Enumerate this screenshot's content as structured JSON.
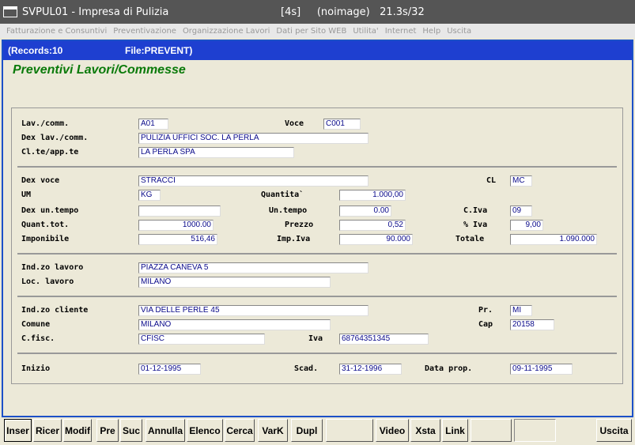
{
  "window": {
    "title": "SVPUL01 - Impresa di Pulizia",
    "info": "[4s]     (noimage)   21.3s/32"
  },
  "menu": [
    "Fatturazione e Consuntivi",
    "Preventivazione",
    "Organizzazione Lavori",
    "Dati per Sito WEB",
    "Utilita'",
    "Internet",
    "Help",
    "Uscita"
  ],
  "header": {
    "records": "(Records:10",
    "file": "File:PREVENT)"
  },
  "page_title": "Preventivi Lavori/Commesse",
  "labels": {
    "lav_comm": "Lav./comm.",
    "voce": "Voce",
    "dex_lav_comm": "Dex lav./comm.",
    "clte_appte": "Cl.te/app.te",
    "dex_voce": "Dex voce",
    "cl": "CL",
    "um": "UM",
    "quantita": "Quantita`",
    "dex_un_tempo": "Dex un.tempo",
    "un_tempo": "Un.tempo",
    "c_iva": "C.Iva",
    "quant_tot": "Quant.tot.",
    "prezzo": "Prezzo",
    "perc_iva": "% Iva",
    "imponibile": "Imponibile",
    "imp_iva": "Imp.Iva",
    "totale": "Totale",
    "ind_lavoro": "Ind.zo lavoro",
    "loc_lavoro": "Loc. lavoro",
    "ind_cliente": "Ind.zo cliente",
    "pr": "Pr.",
    "comune": "Comune",
    "cap": "Cap",
    "c_fisc": "C.fisc.",
    "iva": "Iva",
    "inizio": "Inizio",
    "scad": "Scad.",
    "data_prop": "Data prop."
  },
  "fields": {
    "lav_comm": "A01",
    "voce": "C001",
    "dex_lav_comm": "PULIZIA UFFICI SOC. LA PERLA",
    "clte_appte": "LA PERLA SPA",
    "dex_voce": "STRACCI",
    "cl": "MC",
    "um": "KG",
    "quantita": "1.000,00",
    "dex_un_tempo": "",
    "un_tempo": "0.00",
    "c_iva": "09",
    "quant_tot": "1000.00",
    "prezzo": "0,52",
    "perc_iva": "9,00",
    "imponibile": "516,46",
    "imp_iva": "90.000",
    "totale": "1.090.000",
    "ind_lavoro": "PIAZZA CANEVA 5",
    "loc_lavoro": "MILANO",
    "ind_cliente": "VIA DELLE PERLE 45",
    "pr": "MI",
    "comune": "MILANO",
    "cap": "20158",
    "c_fisc": "CFISC",
    "iva": "68764351345",
    "inizio": "01-12-1995",
    "scad": "31-12-1996",
    "data_prop": "09-11-1995"
  },
  "buttons": {
    "inser": "Inser",
    "ricer": "Ricer",
    "modif": "Modif",
    "pre": "Pre",
    "suc": "Suc",
    "annulla": "Annulla",
    "elenco": "Elenco",
    "cerca": "Cerca",
    "vark": "VarK",
    "dupl": "Dupl",
    "video": "Video",
    "xsta": "Xsta",
    "link": "Link",
    "uscita": "Uscita"
  }
}
